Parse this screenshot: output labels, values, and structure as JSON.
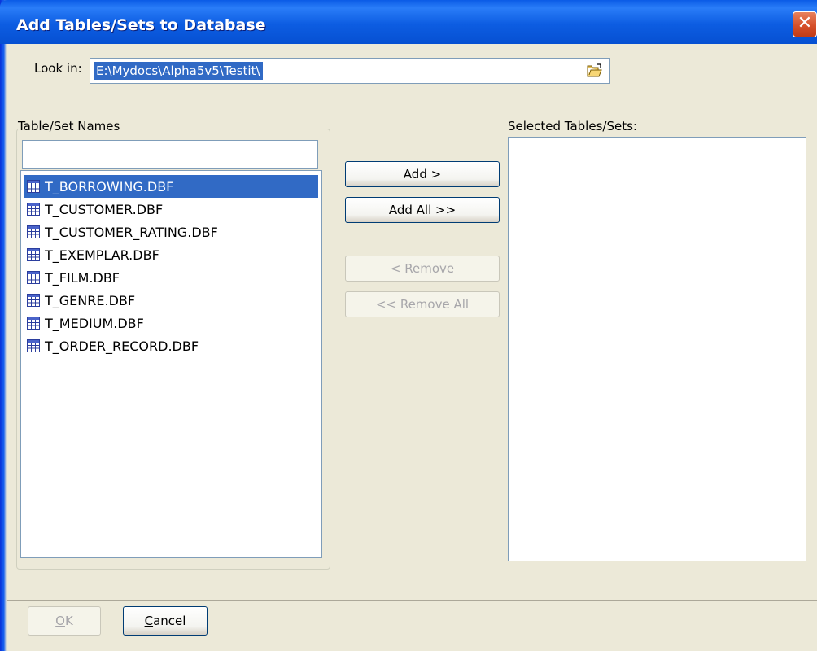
{
  "window": {
    "title": "Add Tables/Sets to Database",
    "close_symbol": "✕"
  },
  "lookin": {
    "label": "Look in:",
    "value": "E:\\Mydocs\\Alpha5v5\\Testit\\",
    "browse_icon": "open-folder-icon"
  },
  "available": {
    "label": "Table/Set Names",
    "filter_value": "",
    "item_icon": "table-icon",
    "items": [
      "T_BORROWING.DBF",
      "T_CUSTOMER.DBF",
      "T_CUSTOMER_RATING.DBF",
      "T_EXEMPLAR.DBF",
      "T_FILM.DBF",
      "T_GENRE.DBF",
      "T_MEDIUM.DBF",
      "T_ORDER_RECORD.DBF"
    ],
    "selected_index": 0
  },
  "actions": {
    "add": "Add >",
    "add_all": "Add All >>",
    "remove": "< Remove",
    "remove_all": "<< Remove All"
  },
  "selected": {
    "label": "Selected Tables/Sets:",
    "items": []
  },
  "footer": {
    "ok_mnemonic": "O",
    "ok_rest": "K",
    "cancel_mnemonic": "C",
    "cancel_rest": "ancel"
  },
  "colors": {
    "titlebar": "#0A5BE6",
    "selection": "#316AC5",
    "dialog_bg": "#ECE9D8",
    "close": "#D6502A"
  }
}
